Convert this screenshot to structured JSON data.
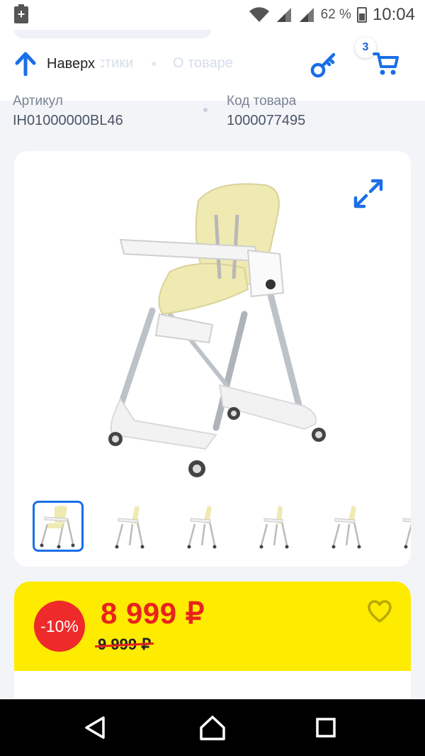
{
  "status_bar": {
    "battery_badge": "+",
    "battery_percent": "62 %",
    "time": "10:04",
    "icons": [
      "wifi-icon",
      "signal-icon",
      "signal-icon",
      "battery-icon"
    ]
  },
  "app_bar": {
    "back_to_top_label": "Наверх",
    "tab_ghost_1": "Характеристики",
    "tab_ghost_2": "О товаре",
    "cart_count": "3",
    "accent": "#1a6ee8"
  },
  "product_meta": {
    "article_label": "Артикул",
    "article_value": "IH01000000BL46",
    "code_label": "Код товара",
    "code_value": "1000077495"
  },
  "gallery": {
    "thumbnail_count": 6,
    "active_index": 0
  },
  "price_block": {
    "discount": "-10%",
    "price": "8 999 ₽",
    "old_price": "9 999 ₽",
    "background": "#fdeb00",
    "price_color": "#e8231e"
  },
  "nav_bar": {
    "buttons": [
      "back-icon",
      "home-icon",
      "recents-icon"
    ]
  }
}
